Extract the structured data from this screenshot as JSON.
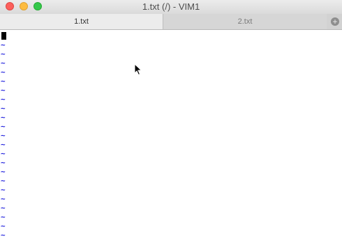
{
  "window": {
    "title": "1.txt (/) - VIM1"
  },
  "tabs": [
    {
      "label": "1.txt",
      "active": true
    },
    {
      "label": "2.txt",
      "active": false
    }
  ],
  "new_tab_glyph": "+",
  "editor": {
    "empty_line_marker": "~",
    "empty_line_count": 22
  },
  "colors": {
    "tilde": "#2222dd",
    "close": "#fc605c",
    "minimize": "#fdbc40",
    "maximize": "#34c84a"
  }
}
